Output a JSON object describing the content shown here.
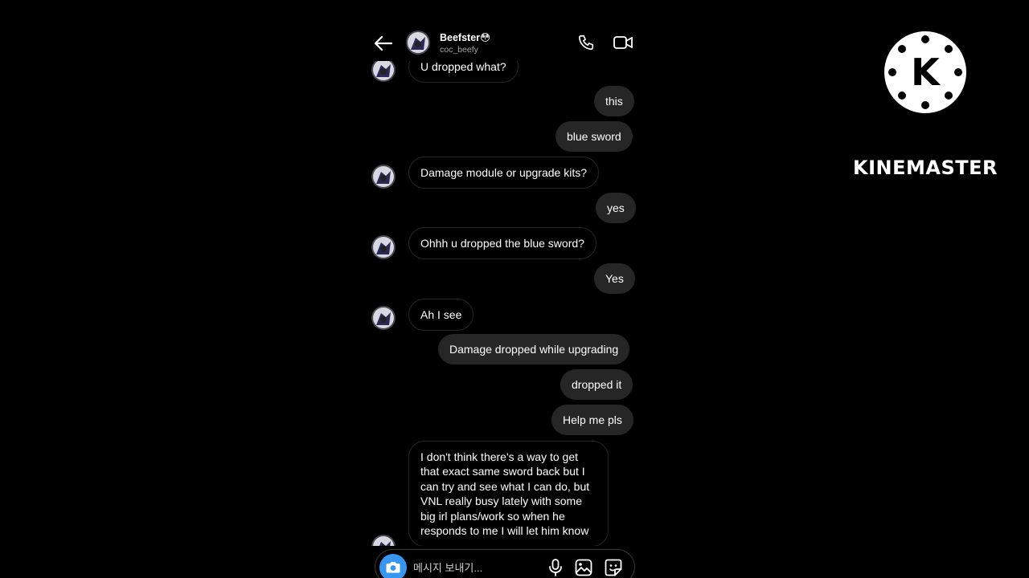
{
  "header": {
    "contact_name": "Beefster😳",
    "contact_handle": "coc_beefy"
  },
  "messages": [
    {
      "from": "them",
      "text": "U dropped what?"
    },
    {
      "from": "me",
      "text": "this"
    },
    {
      "from": "me",
      "text": "blue sword"
    },
    {
      "from": "them",
      "text": "Damage module or upgrade kits?"
    },
    {
      "from": "me",
      "text": "yes"
    },
    {
      "from": "them",
      "text": "Ohhh u dropped the blue sword?"
    },
    {
      "from": "me",
      "text": "Yes"
    },
    {
      "from": "them",
      "text": "Ah I see"
    },
    {
      "from": "me",
      "text": "Damage dropped while upgrading"
    },
    {
      "from": "me",
      "text": "dropped it"
    },
    {
      "from": "me",
      "text": "Help me pls"
    },
    {
      "from": "them",
      "text": "I don't think there's a way to get that exact same sword back but I can try and see what I can do, but VNL really busy lately with some big irl plans/work so when he responds to me I will let him know"
    }
  ],
  "composer": {
    "placeholder": "메시지 보내기..."
  },
  "watermark": {
    "brand": "KINEMASTER",
    "logo_letter": "K"
  },
  "colors": {
    "background": "#000000",
    "outgoing_bubble": "#262626",
    "incoming_border": "#262626",
    "camera_button": "#3797f0",
    "secondary_text": "#a8a8a8"
  },
  "icons": [
    "back-arrow-icon",
    "phone-icon",
    "video-camera-icon",
    "camera-icon",
    "microphone-icon",
    "gallery-icon",
    "sticker-icon"
  ]
}
